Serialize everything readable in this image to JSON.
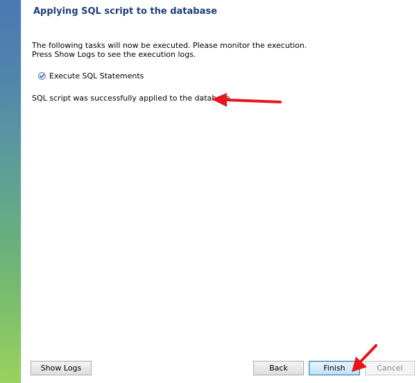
{
  "wizard": {
    "title": "Applying SQL script to the database",
    "description_line1": "The following tasks will now be executed. Please monitor the execution.",
    "description_line2": "Press Show Logs to see the execution logs.",
    "tasks": [
      {
        "label": "Execute SQL Statements",
        "status": "completed",
        "icon": "check-icon"
      }
    ],
    "result_message": "SQL script was successfully applied to the database."
  },
  "buttons": {
    "show_logs": "Show Logs",
    "back": "Back",
    "finish": "Finish",
    "cancel": "Cancel"
  },
  "colors": {
    "title": "#1f3f78",
    "annotation_arrow": "#e8141c",
    "check": "#2d5fa8"
  },
  "annotations": [
    {
      "shape": "red-arrow",
      "points_to": "result-message"
    },
    {
      "shape": "red-arrow",
      "points_to": "finish-button"
    }
  ]
}
